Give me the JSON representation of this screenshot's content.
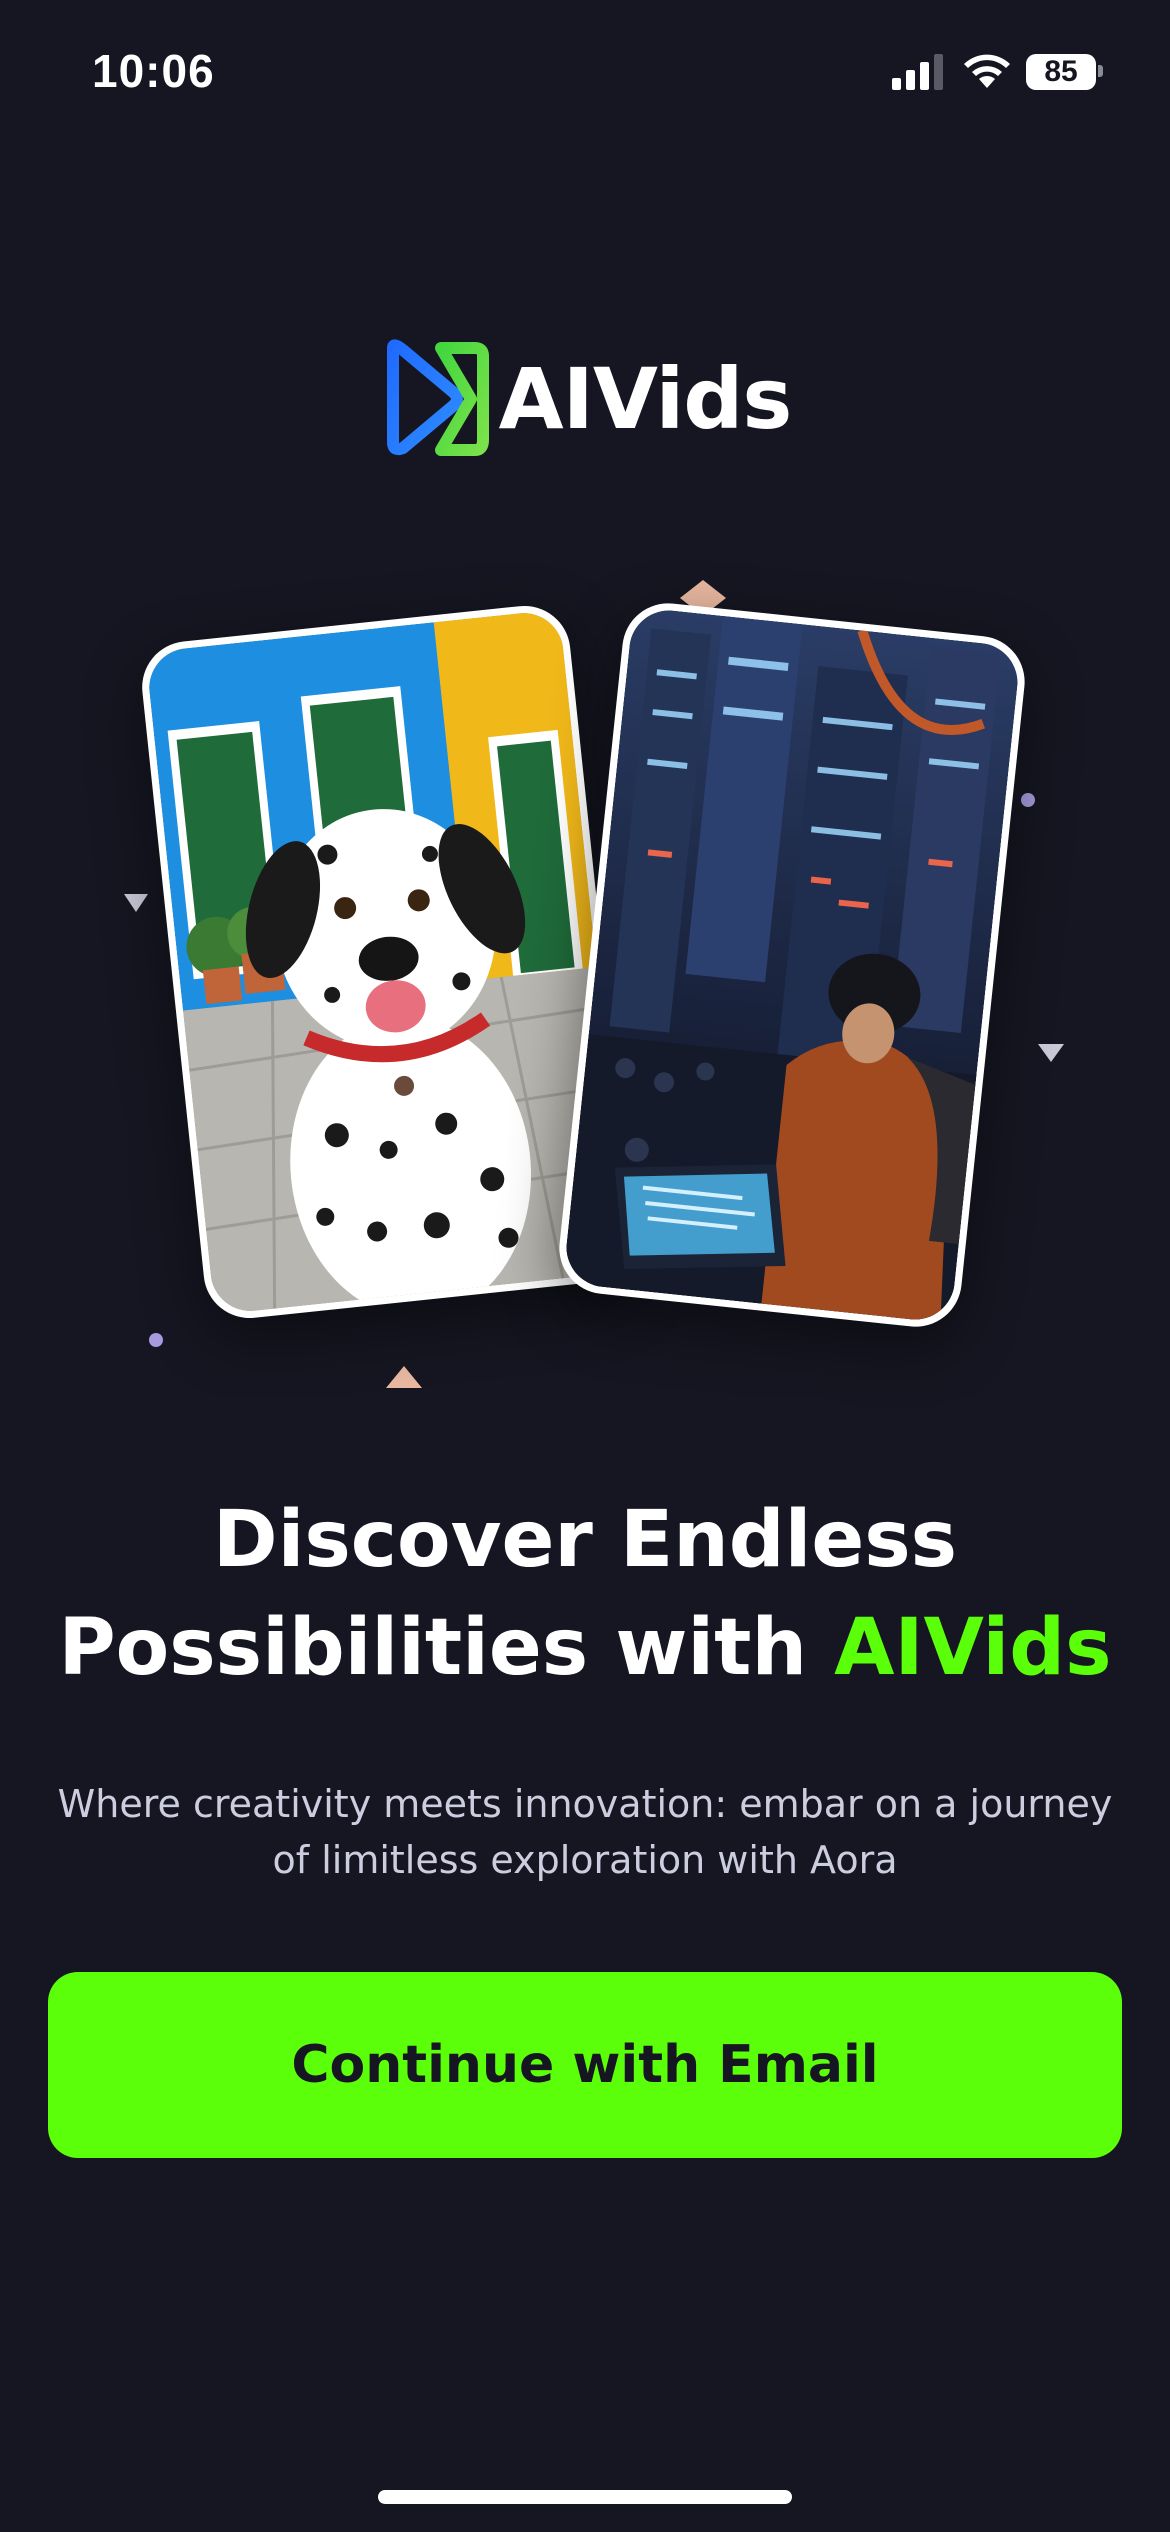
{
  "status_bar": {
    "time": "10:06",
    "battery_level": "85",
    "icons": [
      "signal-icon",
      "wifi-icon",
      "battery-icon"
    ]
  },
  "logo": {
    "text": "AIVids",
    "icon": "play-logo-icon"
  },
  "hero": {
    "left_card": "dalmatian-dog-photo",
    "right_card": "cyberpunk-hacker-photo"
  },
  "headline": {
    "line1": "Discover Endless",
    "line2_prefix": "Possibilities with ",
    "accent": "AIVids"
  },
  "subtitle": "Where creativity meets innovation: embar on a journey of limitless exploration with Aora",
  "cta": {
    "label": "Continue with Email"
  },
  "colors": {
    "background": "#161622",
    "accent": "#5cff0a",
    "text": "#ffffff",
    "subtext": "#cdcde0"
  }
}
